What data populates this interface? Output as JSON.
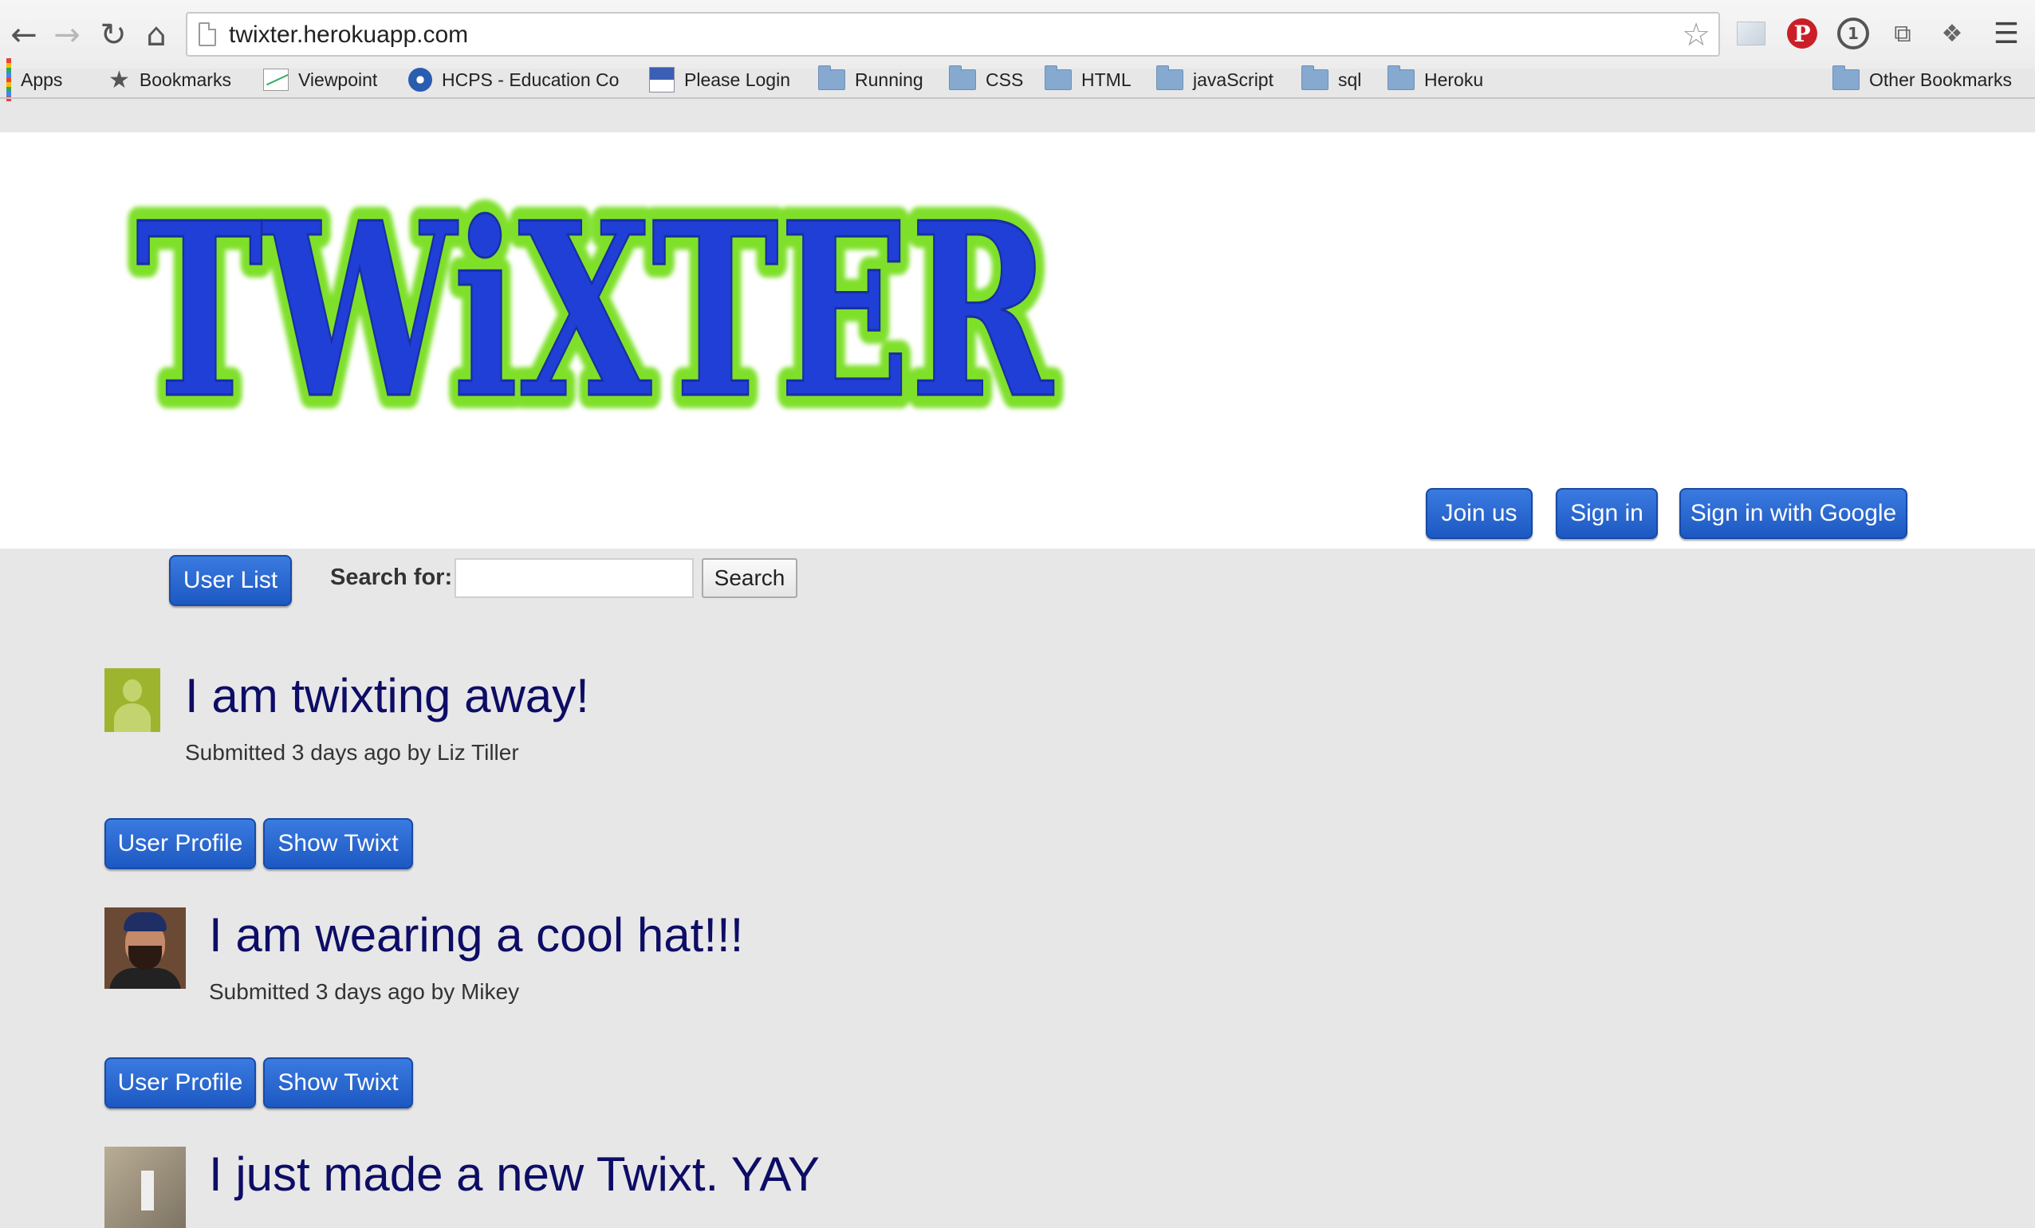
{
  "browser": {
    "url": "twixter.herokuapp.com",
    "bookmarks": [
      {
        "label": "Apps"
      },
      {
        "label": "Bookmarks"
      },
      {
        "label": "Viewpoint"
      },
      {
        "label": "HCPS - Education Co"
      },
      {
        "label": "Please Login"
      },
      {
        "label": "Running"
      },
      {
        "label": "CSS"
      },
      {
        "label": "HTML"
      },
      {
        "label": "javaScript"
      },
      {
        "label": "sql"
      },
      {
        "label": "Heroku"
      }
    ],
    "other_bookmarks": "Other Bookmarks",
    "icons": {
      "back": "back-arrow-icon",
      "forward": "forward-arrow-icon",
      "reload": "reload-icon",
      "home": "home-icon",
      "star": "star-icon",
      "menu": "hamburger-menu-icon"
    }
  },
  "header": {
    "logo_text": "TWiXTER",
    "join_label": "Join us",
    "signin_label": "Sign in",
    "google_label": "Sign in with Google"
  },
  "toolbar": {
    "user_list_label": "User List",
    "search_label": "Search for:",
    "search_value": "",
    "search_button": "Search"
  },
  "posts": [
    {
      "title": "I am twixting away!",
      "meta": "Submitted 3 days ago by Liz Tiller",
      "profile_label": "User Profile",
      "show_label": "Show Twixt"
    },
    {
      "title": "I am wearing a cool hat!!!",
      "meta": "Submitted 3 days ago by Mikey",
      "profile_label": "User Profile",
      "show_label": "Show Twixt"
    },
    {
      "title": "I just made a new Twixt. YAY"
    }
  ],
  "colors": {
    "button_blue": "#1d58c2",
    "title_navy": "#0d0d66",
    "logo_blue": "#1f3fd6",
    "logo_green": "#7fe02a"
  }
}
